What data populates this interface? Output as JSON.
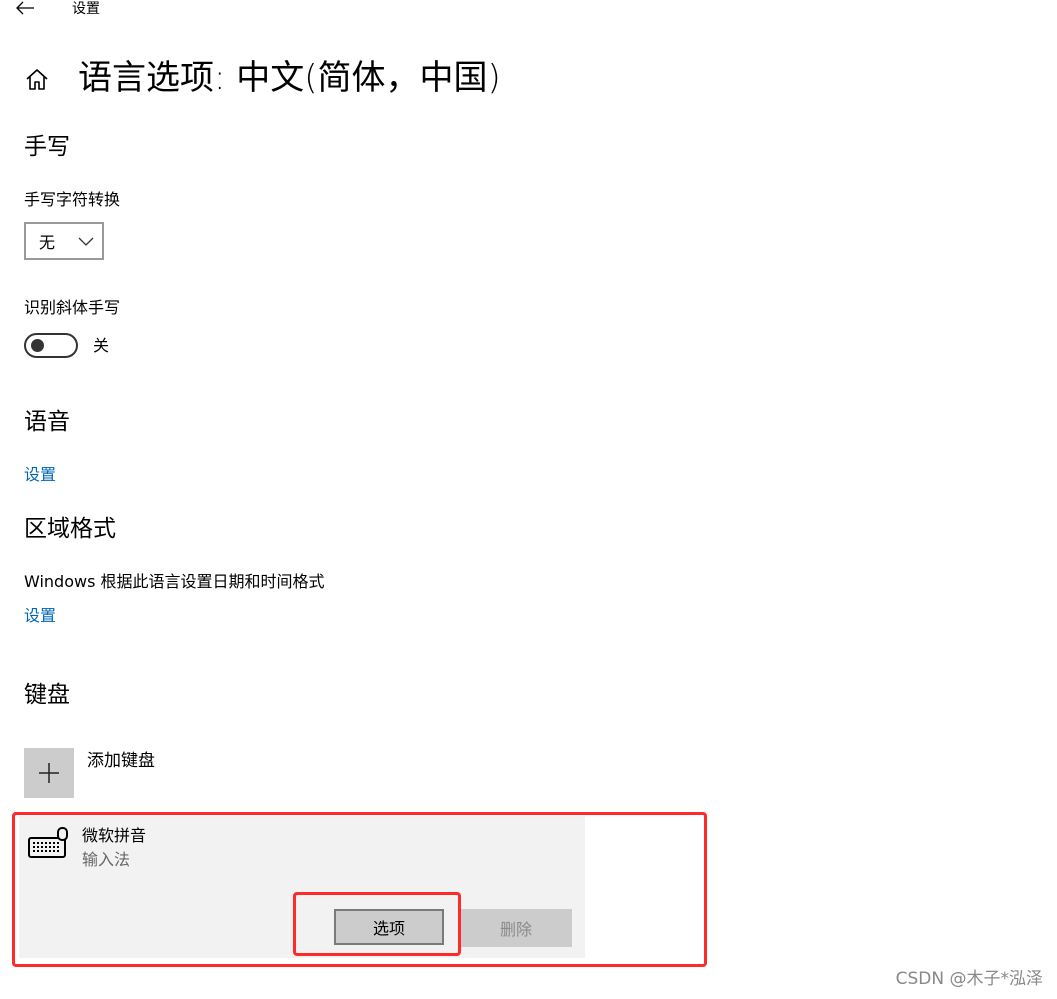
{
  "window": {
    "title": "设置"
  },
  "page": {
    "title": "语言选项: 中文(简体，中国)"
  },
  "handwriting": {
    "section_title": "手写",
    "conversion_label": "手写字符转换",
    "conversion_value": "无",
    "italic_label": "识别斜体手写",
    "italic_toggle_state": "关"
  },
  "speech": {
    "section_title": "语音",
    "settings_link": "设置"
  },
  "region": {
    "section_title": "区域格式",
    "description": "Windows 根据此语言设置日期和时间格式",
    "settings_link": "设置"
  },
  "keyboard": {
    "section_title": "键盘",
    "add_label": "添加键盘",
    "items": [
      {
        "name": "微软拼音",
        "type": "输入法",
        "options_button": "选项",
        "delete_button": "删除"
      }
    ]
  },
  "watermark": "CSDN @木子*泓泽",
  "colors": {
    "link": "#0067b8",
    "highlight": "#ff2a2a",
    "card_bg": "#f2f2f2"
  }
}
